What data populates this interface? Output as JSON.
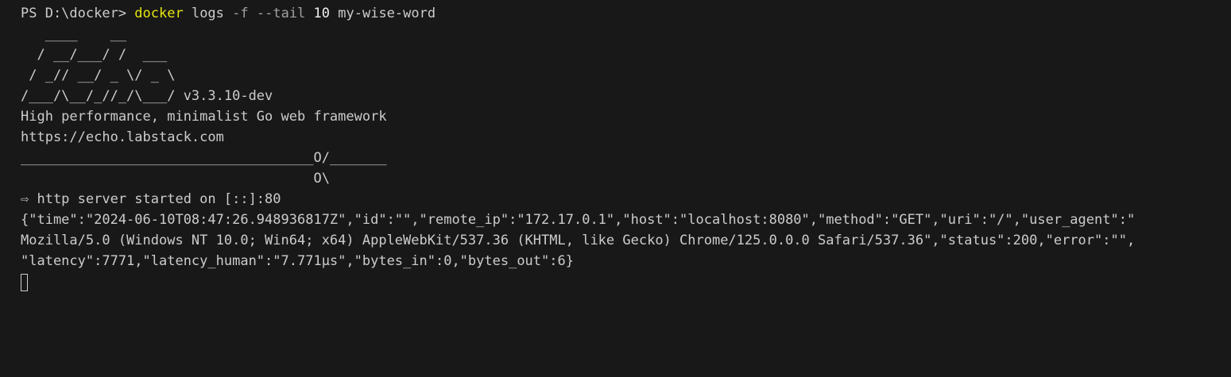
{
  "prompt": {
    "path": "PS D:\\docker> ",
    "command": "docker",
    "args": " logs ",
    "flag1": "-f",
    "space1": " ",
    "flag2": "--tail",
    "space2": " ",
    "number": "10",
    "container": " my-wise-word"
  },
  "banner": [
    "   ____    __",
    "  / __/___/ /  ___",
    " / _// __/ _ \\/ _ \\",
    "/___/\\__/_//_/\\___/ v3.3.10-dev",
    "High performance, minimalist Go web framework",
    "https://echo.labstack.com",
    "____________________________________O/_______",
    "                                    O\\"
  ],
  "log": [
    "⇨ http server started on [::]:80",
    "{\"time\":\"2024-06-10T08:47:26.948936817Z\",\"id\":\"\",\"remote_ip\":\"172.17.0.1\",\"host\":\"localhost:8080\",\"method\":\"GET\",\"uri\":\"/\",\"user_agent\":\"",
    "Mozilla/5.0 (Windows NT 10.0; Win64; x64) AppleWebKit/537.36 (KHTML, like Gecko) Chrome/125.0.0.0 Safari/537.36\",\"status\":200,\"error\":\"\",",
    "\"latency\":7771,\"latency_human\":\"7.771µs\",\"bytes_in\":0,\"bytes_out\":6}"
  ],
  "colors": {
    "background": "#181818",
    "text": "#cccccc",
    "command": "#e5e510",
    "flag": "#a0a0a0"
  }
}
